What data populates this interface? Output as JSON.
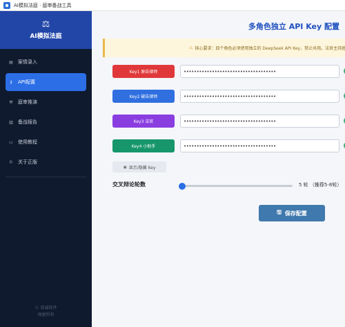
{
  "window": {
    "title": "AI模拟法庭 · 庭审备战工具"
  },
  "sidebar": {
    "brand_icon": "⚖",
    "brand_name": "AI模拟法庭",
    "items": [
      {
        "label": "案情录入",
        "icon": "doc-icon",
        "glyph": "▤",
        "active": false
      },
      {
        "label": "API配置",
        "icon": "key-icon",
        "glyph": "⚷",
        "active": true
      },
      {
        "label": "庭审推演",
        "icon": "gavel-icon",
        "glyph": "⚒",
        "active": false
      },
      {
        "label": "备战报告",
        "icon": "report-icon",
        "glyph": "▥",
        "active": false
      },
      {
        "label": "使用教程",
        "icon": "book-icon",
        "glyph": "▭",
        "active": false
      },
      {
        "label": "关于正版",
        "icon": "copyright-icon",
        "glyph": "©",
        "active": false
      }
    ],
    "footer_line1": "© 亚瑞软件",
    "footer_line2": "保留所有"
  },
  "main": {
    "page_title": "多角色独立 API Key 配置",
    "notice_icon": "⚠",
    "notice_text": "核心要求：四个角色必须使用独立的 DeepSeek API Key，禁止共用。法官主持庭审,",
    "keys": [
      {
        "label": "Key1  原告律师",
        "color": "#e0383a",
        "value": "••••••••••••••••••••••••••••••••••••"
      },
      {
        "label": "Key2  被告律师",
        "color": "#2f6fe0",
        "value": "••••••••••••••••••••••••••••••••••••"
      },
      {
        "label": "Key3  法官",
        "color": "#8a3ee0",
        "value": "••••••••••••••••••••••••••••••••••••"
      },
      {
        "label": "Key4  小助手",
        "color": "#16966a",
        "value": "••••••••••••••••••••••••••••••••••••"
      }
    ],
    "toggle_label": "显示/隐藏 Key",
    "rounds_label": "交叉辩论轮数",
    "rounds_value": "5 轮 （推荐5-8轮）",
    "rounds_slider": {
      "value": 5,
      "min": 5,
      "max": 15
    },
    "save_label": "保存配置"
  }
}
